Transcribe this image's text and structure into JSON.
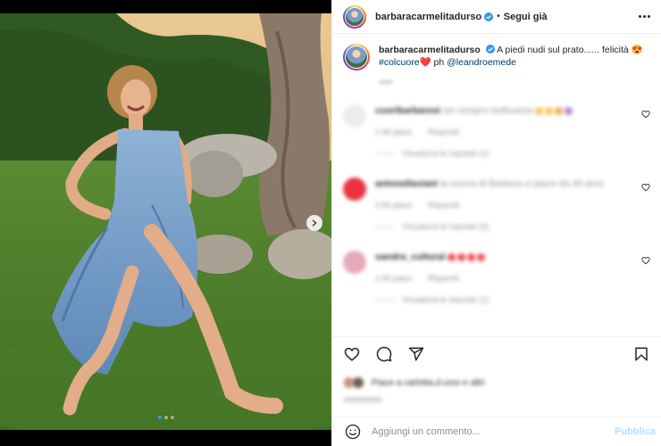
{
  "post": {
    "author": {
      "username": "barbaracarmelitadurso",
      "verified": true,
      "follow_label": "Segui già",
      "separator": "•"
    },
    "caption": {
      "text": "A piedi nudi sul prato...... felicità",
      "hashtag": "#colcuore",
      "heart": "❤️",
      "ph_label": "ph",
      "mention": "@leandroemede"
    },
    "media": {
      "slide_count": 3,
      "active_slide": 1
    }
  },
  "comments": [
    {
      "username": "cuoribarbaresi",
      "text": "sei sempre bellissima",
      "emojis": [
        "#f5c451",
        "#f5c451",
        "#f0a84a",
        "#b07fd8"
      ],
      "meta_like": "1 Mi piace",
      "meta_reply": "Rispondi",
      "replies_label": "Visualizza le risposte (1)",
      "avatar_color": "#ececec"
    },
    {
      "username": "antonellaviani",
      "text": "la crema di Barbara ci piace da 40 anni",
      "emojis": [],
      "meta_like": "2 Mi piace",
      "meta_reply": "Rispondi",
      "replies_label": "Visualizza le risposte (2)",
      "avatar_color": "#e8343f"
    },
    {
      "username": "sandra_cultural",
      "text": "",
      "emojis": [
        "#ed4956",
        "#ed4956",
        "#ed4956",
        "#ed4956"
      ],
      "meta_like": "1 Mi piace",
      "meta_reply": "Rispondi",
      "replies_label": "Visualizza le risposte (1)",
      "avatar_color": "#e6a9b8"
    }
  ],
  "likes": {
    "text": "Piace a carlotta.d.urso e altri"
  },
  "comment_box": {
    "placeholder": "Aggiungi un commento...",
    "publish_label": "Pubblica"
  },
  "colors": {
    "link": "#00376b",
    "publish_disabled": "#b2dffc",
    "verified": "#3897f0",
    "like_red": "#ed4956"
  },
  "icons": [
    "more-icon",
    "verified-icon",
    "next-slide-icon",
    "like-icon",
    "comment-icon",
    "share-icon",
    "save-icon",
    "emoji-icon",
    "heart-icon"
  ]
}
